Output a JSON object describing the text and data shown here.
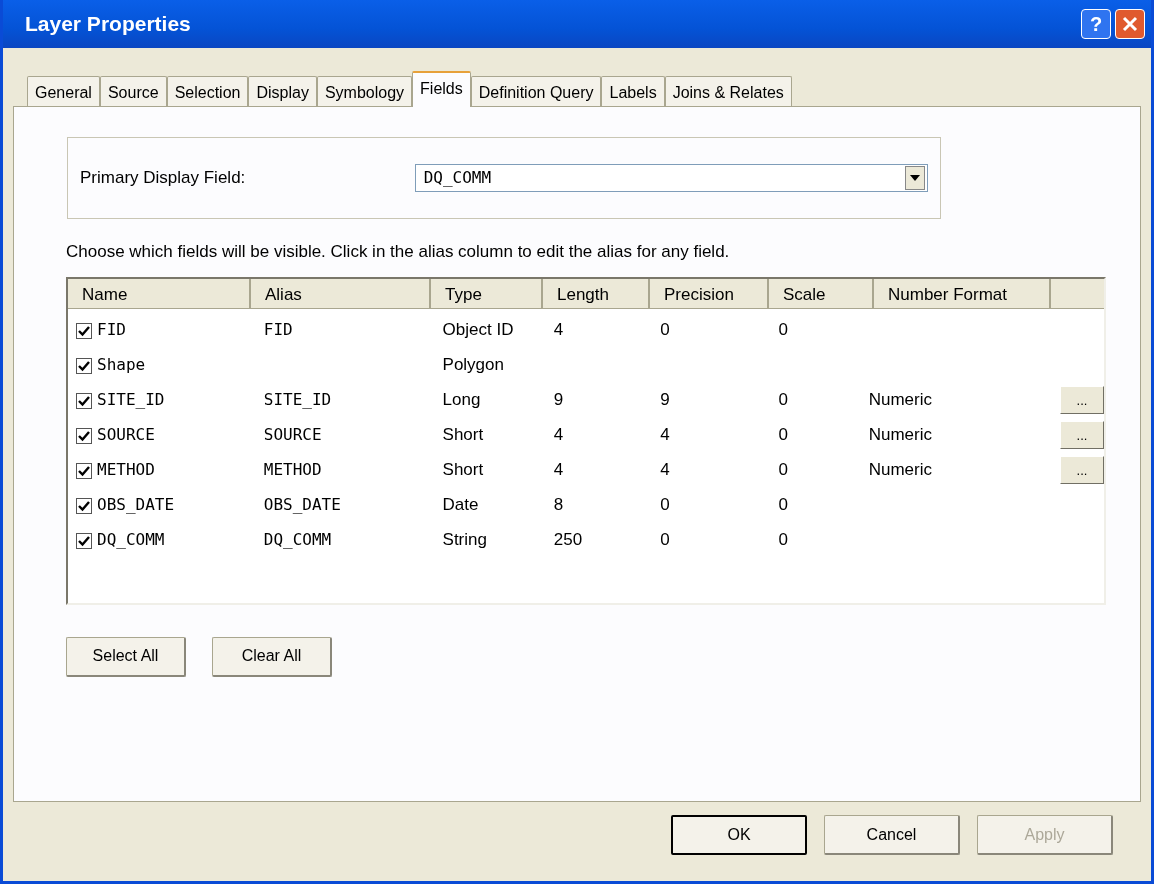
{
  "window": {
    "title": "Layer Properties",
    "help_button": "?"
  },
  "tabs": [
    {
      "label": "General",
      "selected": false
    },
    {
      "label": "Source",
      "selected": false
    },
    {
      "label": "Selection",
      "selected": false
    },
    {
      "label": "Display",
      "selected": false
    },
    {
      "label": "Symbology",
      "selected": false
    },
    {
      "label": "Fields",
      "selected": true
    },
    {
      "label": "Definition Query",
      "selected": false
    },
    {
      "label": "Labels",
      "selected": false
    },
    {
      "label": "Joins & Relates",
      "selected": false
    }
  ],
  "primary_display_field": {
    "label": "Primary Display Field:",
    "value": "DQ_COMM"
  },
  "instructions": "Choose which fields will be visible. Click in the alias column to edit the alias for any field.",
  "table": {
    "columns": [
      "Name",
      "Alias",
      "Type",
      "Length",
      "Precision",
      "Scale",
      "Number Format"
    ],
    "rows": [
      {
        "checked": true,
        "name": "FID",
        "alias": "FID",
        "type": "Object ID",
        "length": "4",
        "precision": "0",
        "scale": "0"
      },
      {
        "checked": true,
        "name": "Shape",
        "type": "Polygon"
      },
      {
        "checked": true,
        "name": "SITE_ID",
        "alias": "SITE_ID",
        "type": "Long",
        "length": "9",
        "precision": "9",
        "scale": "0",
        "number_format": "Numeric",
        "format_button": "..."
      },
      {
        "checked": true,
        "name": "SOURCE",
        "alias": "SOURCE",
        "type": "Short",
        "length": "4",
        "precision": "4",
        "scale": "0",
        "number_format": "Numeric",
        "format_button": "..."
      },
      {
        "checked": true,
        "name": "METHOD",
        "alias": "METHOD",
        "type": "Short",
        "length": "4",
        "precision": "4",
        "scale": "0",
        "number_format": "Numeric",
        "format_button": "..."
      },
      {
        "checked": true,
        "name": "OBS_DATE",
        "alias": "OBS_DATE",
        "type": "Date",
        "length": "8",
        "precision": "0",
        "scale": "0"
      },
      {
        "checked": true,
        "name": "DQ_COMM",
        "alias": "DQ_COMM",
        "type": "String",
        "length": "250",
        "precision": "0",
        "scale": "0"
      }
    ]
  },
  "list_buttons": [
    "Select All",
    "Clear All"
  ],
  "buttons": [
    {
      "label": "OK",
      "default": true,
      "disabled": false
    },
    {
      "label": "Cancel",
      "default": false,
      "disabled": false
    },
    {
      "label": "Apply",
      "default": false,
      "disabled": true
    }
  ]
}
